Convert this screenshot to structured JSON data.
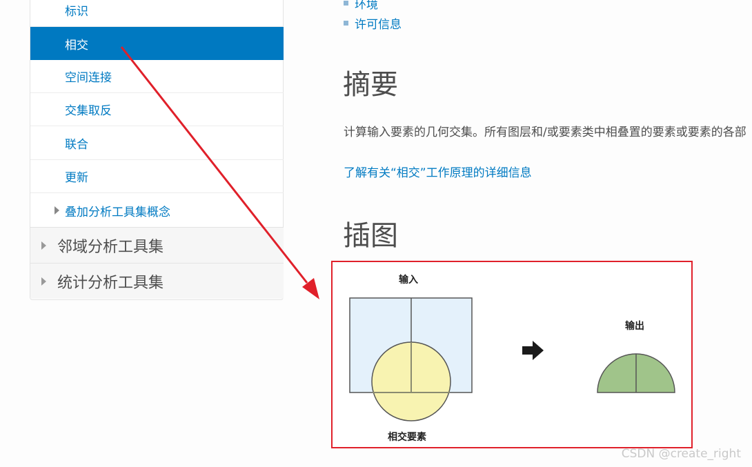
{
  "sidebar": {
    "items": [
      {
        "label": "标识",
        "active": false
      },
      {
        "label": "相交",
        "active": true
      },
      {
        "label": "空间连接",
        "active": false
      },
      {
        "label": "交集取反",
        "active": false
      },
      {
        "label": "联合",
        "active": false
      },
      {
        "label": "更新",
        "active": false
      },
      {
        "label": "叠加分析工具集概念",
        "active": false,
        "expandable": true
      }
    ],
    "groups": [
      {
        "label": "邻域分析工具集"
      },
      {
        "label": "统计分析工具集"
      }
    ]
  },
  "toc": {
    "items": [
      "环境",
      "许可信息"
    ]
  },
  "summary_section": {
    "heading": "摘要",
    "text": "计算输入要素的几何交集。所有图层和/或要素类中相叠置的要素或要素的各部",
    "more_link": "了解有关“相交”工作原理的详细信息"
  },
  "illustration_section": {
    "heading": "插图",
    "input_label": "输入",
    "intersect_label": "相交要素",
    "output_label": "输出"
  },
  "watermark": "CSDN @create_right",
  "colors": {
    "accent_blue": "#0079c1",
    "link_blue": "#007ac2",
    "annotation_red": "#e0202a",
    "input_fill": "#e4f1fb",
    "intersect_fill": "#f8f3b1",
    "output_fill": "#a0c48a"
  }
}
